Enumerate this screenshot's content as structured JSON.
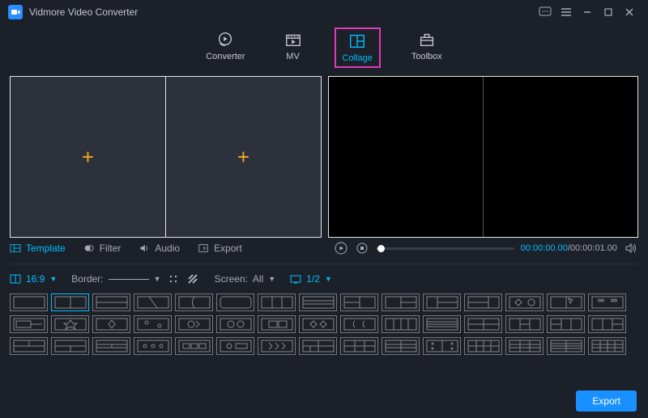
{
  "app": {
    "title": "Vidmore Video Converter"
  },
  "mainTabs": {
    "converter": "Converter",
    "mv": "MV",
    "collage": "Collage",
    "toolbox": "Toolbox"
  },
  "subTabs": {
    "template": "Template",
    "filter": "Filter",
    "audio": "Audio",
    "export": "Export"
  },
  "player": {
    "current": "00:00:00.00",
    "total": "00:00:01.00"
  },
  "options": {
    "ratio": "16:9",
    "borderLabel": "Border:",
    "screenLabel": "Screen:",
    "screenValue": "All",
    "screenCount": "1/2"
  },
  "footer": {
    "export": "Export"
  }
}
